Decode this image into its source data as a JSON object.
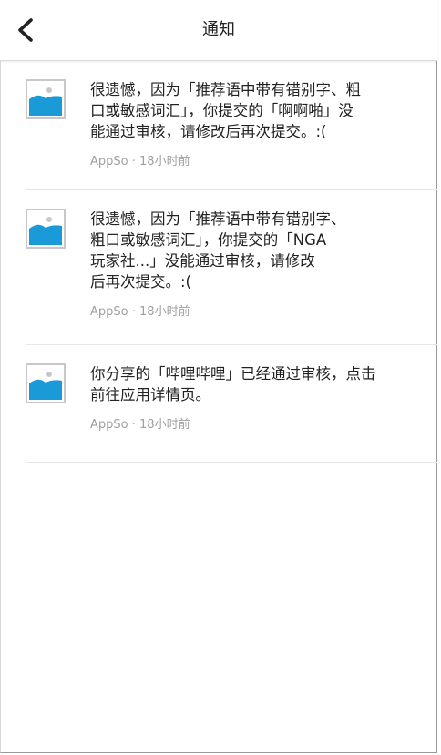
{
  "header": {
    "title": "通知",
    "back_icon": "chevron-left-icon"
  },
  "notifications": [
    {
      "message": "很遗憾，因为「推荐语中带有错别字、粗\n口或敏感词汇」，你提交的「啊啊啪」没\n能通过审核，请修改后再次提交。:(",
      "source": "AppSo",
      "separator": "·",
      "time": "18小时前",
      "thumbnail_icon": "image-placeholder-icon"
    },
    {
      "message": "很遗憾，因为「推荐语中带有错别字、\n粗口或敏感词汇」，你提交的「NGA\n玩家社...」没能通过审核，请修改\n后再次提交。:(",
      "source": "AppSo",
      "separator": "·",
      "time": "18小时前",
      "thumbnail_icon": "image-placeholder-icon"
    },
    {
      "message": "你分享的「哔哩哔哩」已经通过审核，点击\n前往应用详情页。",
      "source": "AppSo",
      "separator": "·",
      "time": "18小时前",
      "thumbnail_icon": "image-placeholder-icon"
    }
  ],
  "colors": {
    "thumbnail_blue": "#1a9ad6",
    "meta_gray": "#a0a0a0",
    "divider": "#e6e6e6"
  }
}
